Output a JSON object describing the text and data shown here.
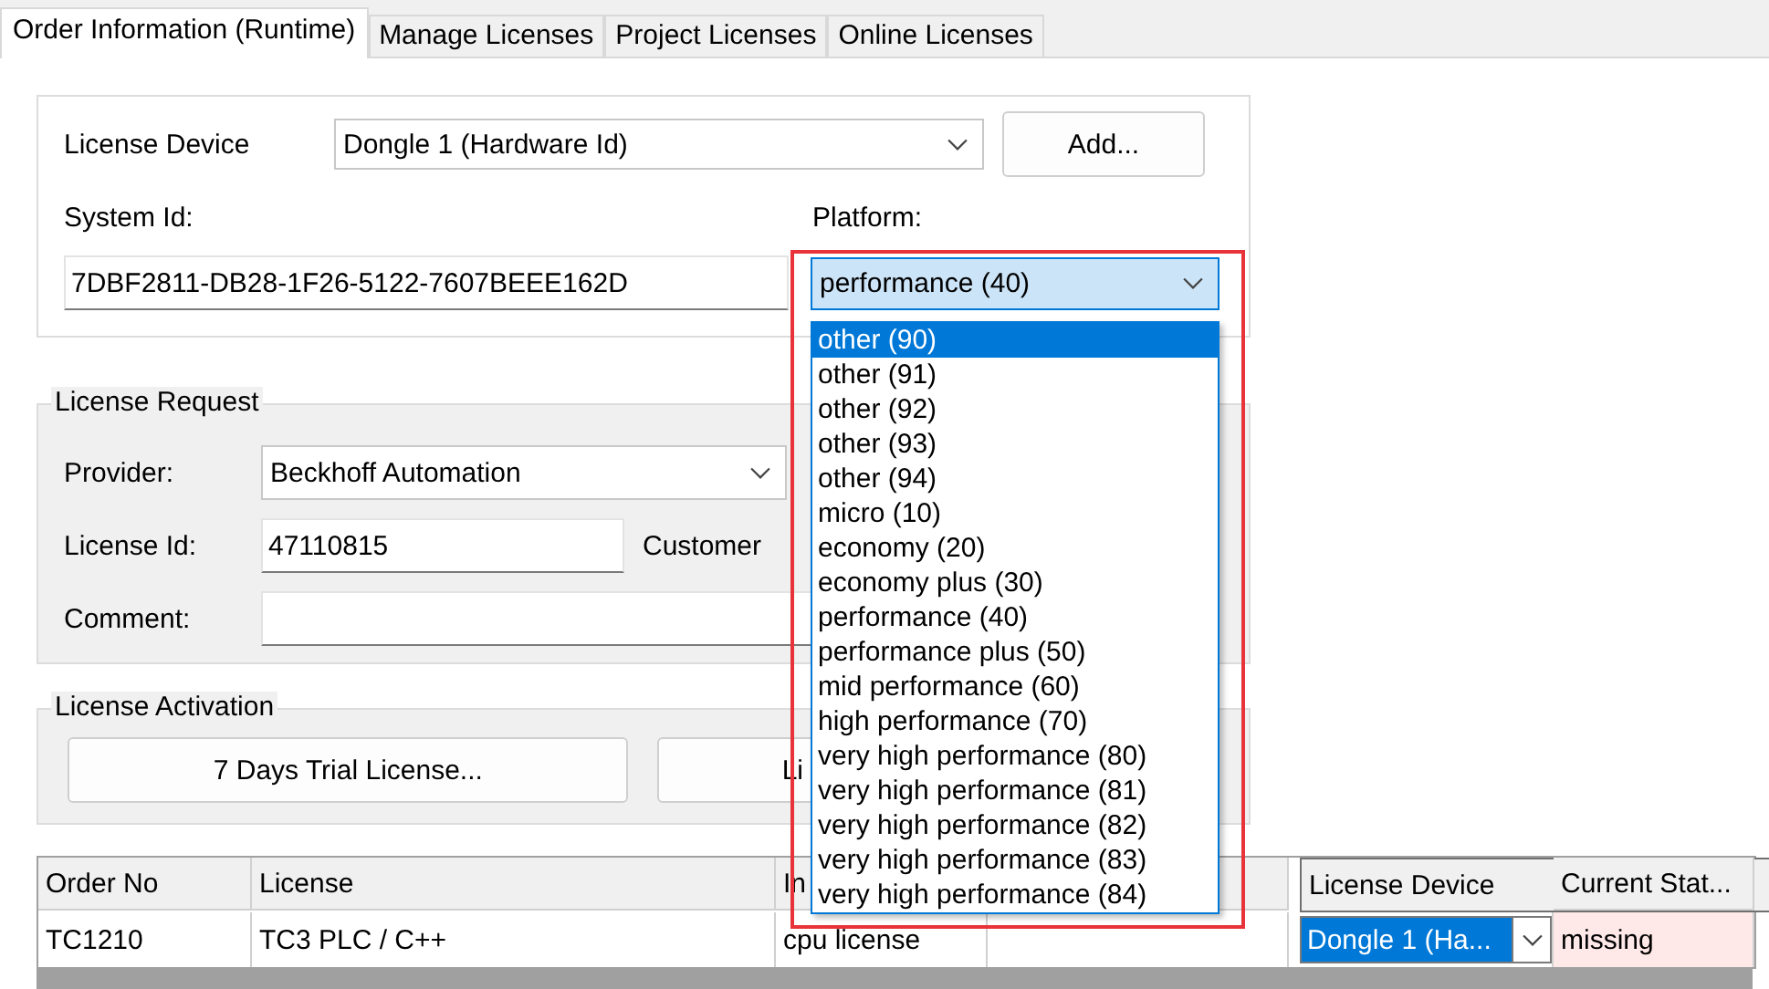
{
  "tabs": [
    {
      "label": "Order Information (Runtime)",
      "selected": true
    },
    {
      "label": "Manage Licenses",
      "selected": false
    },
    {
      "label": "Project Licenses",
      "selected": false
    },
    {
      "label": "Online Licenses",
      "selected": false
    }
  ],
  "device_group": {
    "license_device_label": "License Device",
    "license_device_value": "Dongle 1 (Hardware Id)",
    "add_button": "Add...",
    "system_id_label": "System Id:",
    "system_id_value": "7DBF2811-DB28-1F26-5122-7607BEEE162D",
    "platform_label": "Platform:",
    "platform_value": "performance (40)",
    "platform_open": true
  },
  "platform_options": [
    {
      "label": "other (90)",
      "selected": true
    },
    {
      "label": "other (91)",
      "selected": false
    },
    {
      "label": "other (92)",
      "selected": false
    },
    {
      "label": "other (93)",
      "selected": false
    },
    {
      "label": "other (94)",
      "selected": false
    },
    {
      "label": "micro (10)",
      "selected": false
    },
    {
      "label": "economy (20)",
      "selected": false
    },
    {
      "label": "economy plus (30)",
      "selected": false
    },
    {
      "label": "performance (40)",
      "selected": false
    },
    {
      "label": "performance plus (50)",
      "selected": false
    },
    {
      "label": "mid performance (60)",
      "selected": false
    },
    {
      "label": "high performance (70)",
      "selected": false
    },
    {
      "label": "very high performance (80)",
      "selected": false
    },
    {
      "label": "very high performance (81)",
      "selected": false
    },
    {
      "label": "very high performance (82)",
      "selected": false
    },
    {
      "label": "very high performance (83)",
      "selected": false
    },
    {
      "label": "very high performance (84)",
      "selected": false
    }
  ],
  "request_group": {
    "title": "License Request",
    "provider_label": "Provider:",
    "provider_value": "Beckhoff Automation",
    "license_id_label": "License Id:",
    "license_id_value": "47110815",
    "customer_label": "Customer",
    "comment_label": "Comment:"
  },
  "activation_group": {
    "title": "License Activation",
    "buttons": [
      "7 Days Trial License...",
      "Li"
    ]
  },
  "table": {
    "columns": [
      {
        "kind": "text",
        "label": "Order No"
      },
      {
        "kind": "text",
        "label": "License"
      },
      {
        "kind": "text",
        "label": "In"
      },
      {
        "kind": "blank"
      },
      {
        "kind": "text",
        "label": "License Device"
      },
      {
        "kind": "text",
        "label": "Current Stat..."
      }
    ],
    "rows": [
      {
        "order_no": "TC1210",
        "license": "TC3 PLC / C++",
        "column_3": "cpu license",
        "license_device": "Dongle 1 (Ha...",
        "device_selected": true,
        "current_status": "missing"
      }
    ]
  }
}
